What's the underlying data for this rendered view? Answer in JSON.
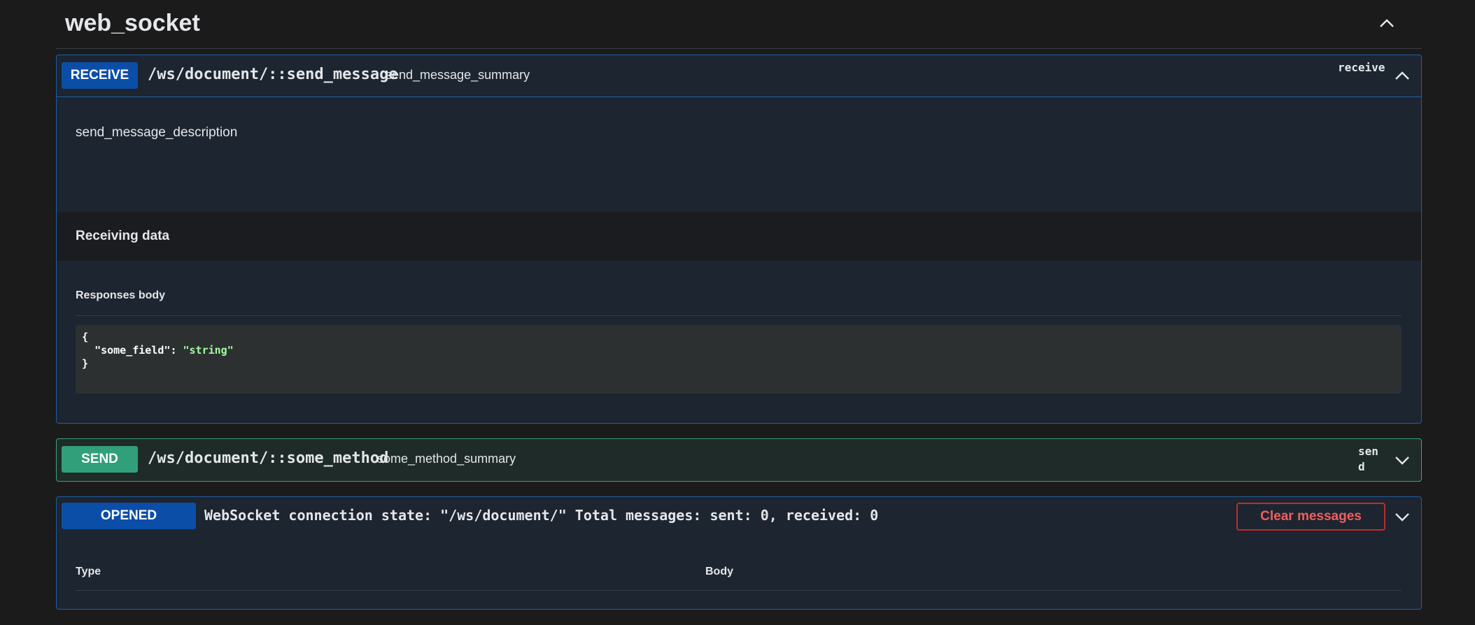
{
  "section": {
    "title": "web_socket"
  },
  "receive_op": {
    "badge": "RECEIVE",
    "path": "/ws/document/::send_message",
    "summary": "send_message_summary",
    "tag": "receive",
    "description": "send_message_description",
    "receiving_title": "Receiving data",
    "responses_label": "Responses body",
    "code": {
      "open": "{",
      "key": "\"some_field\"",
      "sep": ": ",
      "value": "\"string\"",
      "close": "}"
    }
  },
  "send_op": {
    "badge": "SEND",
    "path": "/ws/document/::some_method",
    "summary": "some_method_summary",
    "tag": "send"
  },
  "ws_panel": {
    "badge": "OPENED",
    "state_text": "WebSocket connection state: \"/ws/document/\" Total messages: sent: 0, received: 0",
    "clear_label": "Clear messages",
    "columns": [
      "Type",
      "Body"
    ]
  },
  "colors": {
    "receive": "#0b4ea8",
    "send": "#31a07a",
    "opened": "#0b4ea8",
    "danger": "#c22b2b"
  },
  "icons": [
    "chevron-up-icon",
    "chevron-down-icon"
  ]
}
